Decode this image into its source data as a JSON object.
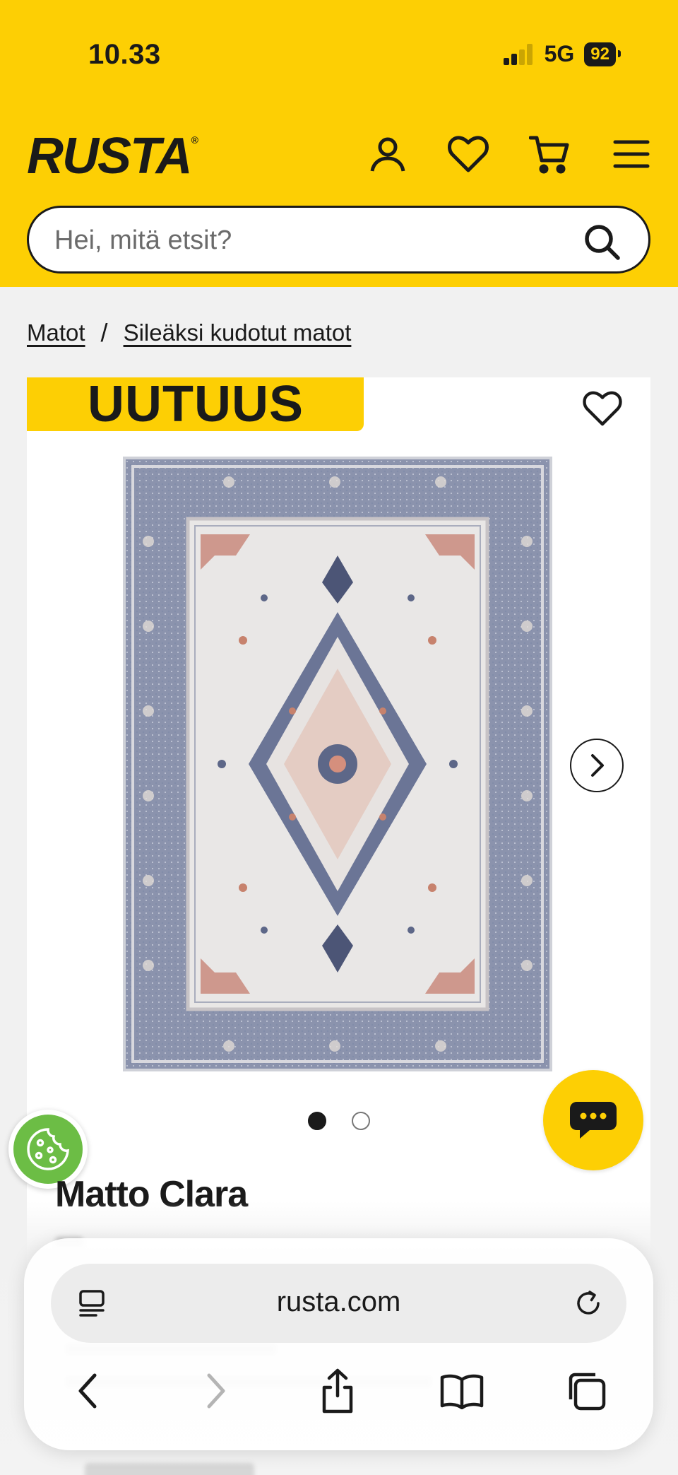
{
  "status_bar": {
    "time": "10.33",
    "network": "5G",
    "battery": "92"
  },
  "header": {
    "logo": "RUSTA",
    "search_placeholder": "Hei, mitä etsit?"
  },
  "breadcrumb": {
    "items": [
      "Matot",
      "Sileäksi kudotut matot"
    ],
    "separator": "/"
  },
  "product": {
    "badge": "UUTUUS",
    "title": "Matto Clara",
    "image_count": 2,
    "active_image": 1
  },
  "browser": {
    "url": "rusta.com"
  },
  "colors": {
    "brand_yellow": "#fdcf04",
    "cookie_green": "#6cbd45",
    "text": "#1a1a1a"
  },
  "icons": [
    "user-icon",
    "heart-icon",
    "cart-icon",
    "menu-icon",
    "search-icon",
    "chevron-right-icon",
    "chat-icon",
    "cookie-icon",
    "reader-icon",
    "reload-icon",
    "back-icon",
    "forward-icon",
    "share-icon",
    "bookmarks-icon",
    "tabs-icon"
  ]
}
